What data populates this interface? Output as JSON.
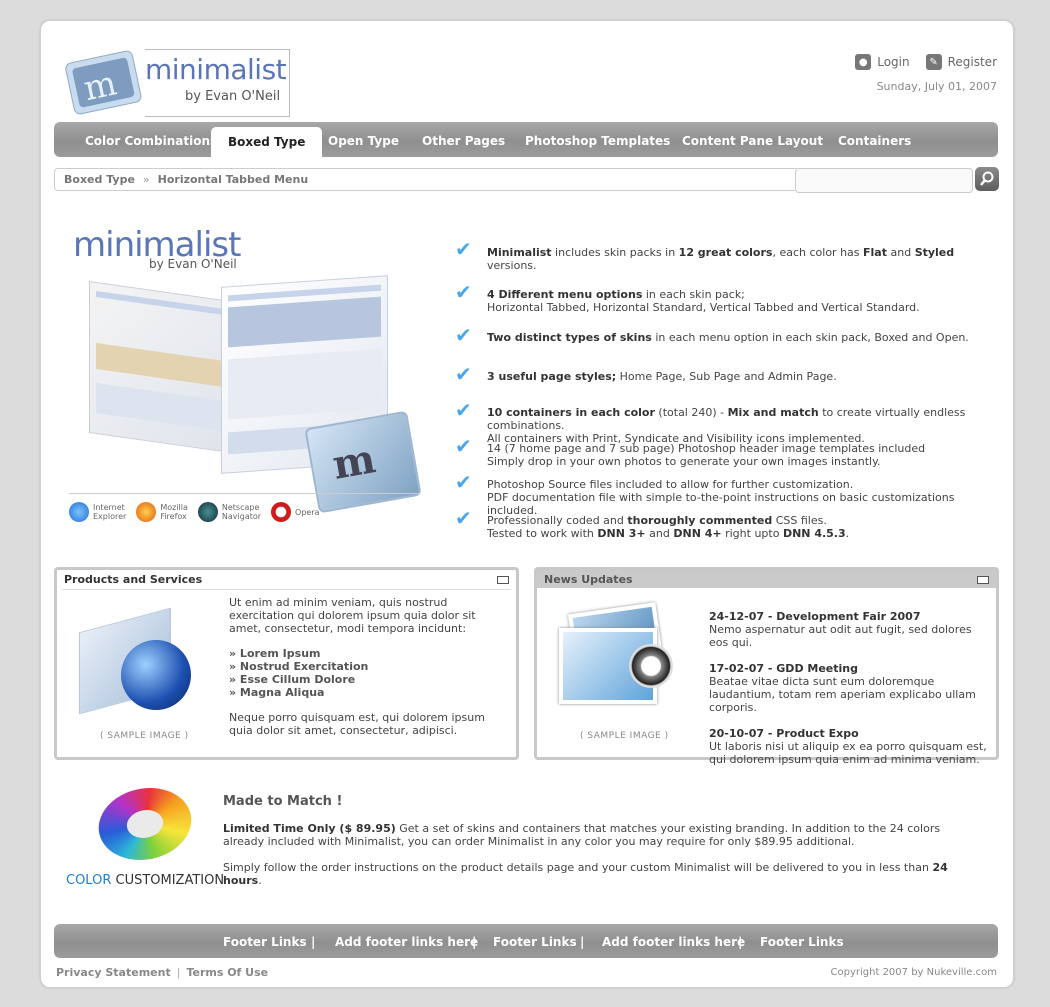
{
  "logo": {
    "word": "minimalist",
    "by": "by Evan O'Neil"
  },
  "header": {
    "login": "Login",
    "register": "Register",
    "date": "Sunday, July 01, 2007"
  },
  "nav": {
    "items": [
      "Color Combinations",
      "Boxed Type",
      "Open Type",
      "Other Pages",
      "Photoshop Templates",
      "Content Pane Layout",
      "Containers"
    ],
    "active": "Boxed Type"
  },
  "breadcrumb": {
    "root": "Boxed Type",
    "separator": "»",
    "current": "Horizontal Tabbed Menu"
  },
  "search": {
    "placeholder": "",
    "icon": "search-icon"
  },
  "hero": {
    "logo_word": "minimalist",
    "logo_by": "by Evan O'Neil",
    "browsers": [
      {
        "line1": "Internet",
        "line2": "Explorer"
      },
      {
        "line1": "Mozilla",
        "line2": "Firefox"
      },
      {
        "line1": "Netscape",
        "line2": "Navigator"
      },
      {
        "line1": "Opera",
        "line2": ""
      }
    ],
    "features": [
      {
        "b1": "Minimalist",
        "t1": " includes skin packs in ",
        "b2": "12 great colors",
        "t2": ", each color has ",
        "b3": "Flat",
        "t3": " and ",
        "b4": "Styled",
        "t4": " versions.",
        "line2": ""
      },
      {
        "b1": "4 Different menu options",
        "t1": " in each skin pack;",
        "line2": "Horizontal Tabbed, Horizontal Standard, Vertical Tabbed and Vertical Standard."
      },
      {
        "b1": "Two distinct types of skins",
        "t1": " in each menu option in each skin pack, Boxed and Open.",
        "line2": ""
      },
      {
        "b1": "3 useful page styles;",
        "t1": " Home Page, Sub Page and Admin Page.",
        "line2": ""
      },
      {
        "b1": "10 containers in each color",
        "t1": " (total 240) - ",
        "b2": "Mix and match",
        "t2": " to create virtually endless combinations.",
        "line2": "All containers with Print, Syndicate and Visibility icons implemented."
      },
      {
        "t0": "14 (7 home page and 7 sub page) Photoshop header image templates included",
        "line2": "Simply drop in your own photos to generate your own images instantly."
      },
      {
        "t0": "Photoshop Source files included to allow for further customization.",
        "line2": "PDF documentation file with simple to-the-point instructions on basic customizations included."
      },
      {
        "t0": "Professionally coded and ",
        "b1": "thoroughly commented",
        "t1": " CSS files.",
        "l2a": "Tested to work with ",
        "l2b": "DNN 3+",
        "l2c": " and ",
        "l2d": "DNN 4+",
        "l2e": " right upto ",
        "l2f": "DNN 4.5.3",
        "l2g": "."
      }
    ]
  },
  "products": {
    "title": "Products and Services",
    "intro": "Ut enim ad minim veniam, quis nostrud exercitation qui dolorem ipsum quia dolor sit amet, consectetur, modi tempora incidunt:",
    "items": [
      "» Lorem Ipsum",
      "» Nostrud Exercitation",
      "» Esse Cillum Dolore",
      "» Magna Aliqua"
    ],
    "outro": "Neque porro quisquam est, qui dolorem ipsum quia dolor sit amet, consectetur, adipisci.",
    "sample": "( SAMPLE IMAGE )"
  },
  "news": {
    "title": "News Updates",
    "sample": "( SAMPLE IMAGE )",
    "items": [
      {
        "head": "24-12-07 - Development Fair 2007",
        "body": "Nemo aspernatur aut odit aut fugit, sed dolores eos qui."
      },
      {
        "head": "17-02-07 - GDD Meeting",
        "body": "Beatae vitae dicta sunt eum doloremque laudantium, totam rem aperiam explicabo ullam corporis."
      },
      {
        "head": "20-10-07 - Product Expo",
        "body": "Ut laboris nisi ut aliquip ex ea porro quisquam est, qui dolorem ipsum quia enim ad minima veniam."
      }
    ]
  },
  "customization": {
    "label_color": "COLOR",
    "label_rest": " CUSTOMIZATION",
    "title": "Made to Match !",
    "p1_bold": "Limited Time Only ($ 89.95)",
    "p1_rest": " Get a set of skins and containers that matches your existing branding. In addition to the 24 colors already included with Minimalist, you can order Minimalist in any color you may require for only $89.95 additional.",
    "p2_text": "Simply follow the order instructions on the product details page and your custom Minimalist will be delivered to you in less than ",
    "p2_bold": "24 hours",
    "p2_end": "."
  },
  "footer": {
    "links": [
      "Footer Links",
      "|",
      "Add footer links here",
      "|",
      "Footer Links",
      "|",
      "Add footer links here",
      "|",
      "Footer Links"
    ],
    "privacy": "Privacy Statement",
    "sep": "|",
    "terms": "Terms Of Use",
    "copyright": "Copyright 2007 by Nukeville.com"
  },
  "colors": {
    "accent": "#5b76b8",
    "check": "#49a6e8",
    "nav_bg": "#999999",
    "cc_blue": "#1f7ed0"
  }
}
